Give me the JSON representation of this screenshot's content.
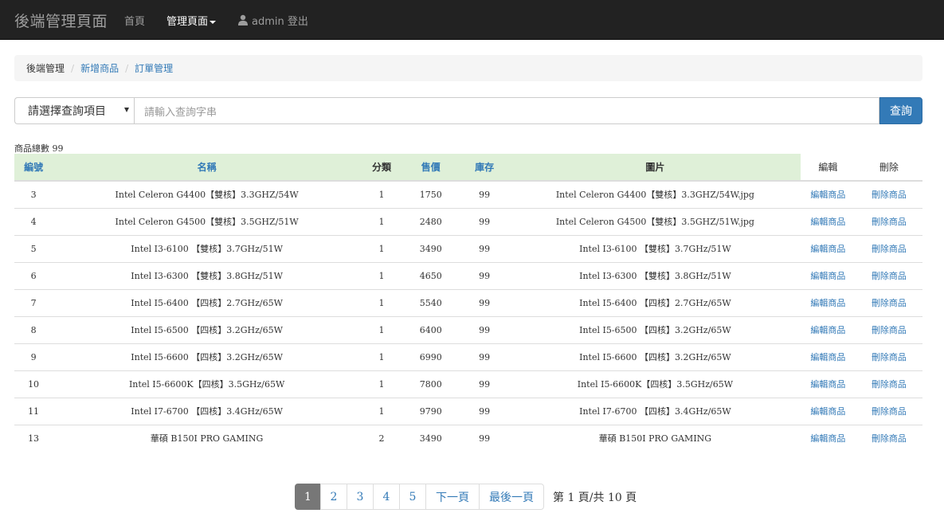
{
  "navbar": {
    "brand": "後端管理頁面",
    "home": "首頁",
    "manage": "管理頁面",
    "user": "admin 登出"
  },
  "breadcrumb": {
    "current": "後端管理",
    "add_product": "新增商品",
    "orders": "訂單管理"
  },
  "search": {
    "select_value": "請選擇查詢項目",
    "placeholder": "請輸入查詢字串",
    "button": "查詢"
  },
  "count_text": "商品總數 99",
  "table": {
    "headers": {
      "id": "編號",
      "name": "名稱",
      "category": "分類",
      "price": "售價",
      "stock": "庫存",
      "image": "圖片",
      "edit": "編輯",
      "delete": "刪除"
    },
    "edit_link": "編輯商品",
    "delete_link": "刪除商品",
    "rows": [
      {
        "id": "3",
        "name": "Intel Celeron G4400【雙核】3.3GHZ/54W",
        "category": "1",
        "price": "1750",
        "stock": "99",
        "image": "Intel Celeron G4400【雙核】3.3GHZ/54W.jpg"
      },
      {
        "id": "4",
        "name": "Intel Celeron G4500【雙核】3.5GHZ/51W",
        "category": "1",
        "price": "2480",
        "stock": "99",
        "image": "Intel Celeron G4500【雙核】3.5GHZ/51W.jpg"
      },
      {
        "id": "5",
        "name": "Intel I3-6100 【雙核】3.7GHz/51W",
        "category": "1",
        "price": "3490",
        "stock": "99",
        "image": "Intel I3-6100 【雙核】3.7GHz/51W"
      },
      {
        "id": "6",
        "name": "Intel I3-6300 【雙核】3.8GHz/51W",
        "category": "1",
        "price": "4650",
        "stock": "99",
        "image": "Intel I3-6300 【雙核】3.8GHz/51W"
      },
      {
        "id": "7",
        "name": "Intel I5-6400 【四核】2.7GHz/65W",
        "category": "1",
        "price": "5540",
        "stock": "99",
        "image": "Intel I5-6400 【四核】2.7GHz/65W"
      },
      {
        "id": "8",
        "name": "Intel I5-6500 【四核】3.2GHz/65W",
        "category": "1",
        "price": "6400",
        "stock": "99",
        "image": "Intel I5-6500 【四核】3.2GHz/65W"
      },
      {
        "id": "9",
        "name": "Intel I5-6600 【四核】3.2GHz/65W",
        "category": "1",
        "price": "6990",
        "stock": "99",
        "image": "Intel I5-6600 【四核】3.2GHz/65W"
      },
      {
        "id": "10",
        "name": "Intel I5-6600K【四核】3.5GHz/65W",
        "category": "1",
        "price": "7800",
        "stock": "99",
        "image": "Intel I5-6600K【四核】3.5GHz/65W"
      },
      {
        "id": "11",
        "name": "Intel I7-6700 【四核】3.4GHz/65W",
        "category": "1",
        "price": "9790",
        "stock": "99",
        "image": "Intel I7-6700 【四核】3.4GHz/65W"
      },
      {
        "id": "13",
        "name": "華碩 B150I PRO GAMING",
        "category": "2",
        "price": "3490",
        "stock": "99",
        "image": "華碩 B150I PRO GAMING"
      }
    ]
  },
  "pagination": {
    "pages": [
      "1",
      "2",
      "3",
      "4",
      "5"
    ],
    "next": "下一頁",
    "last": "最後一頁",
    "info": "第 1 頁/共 10 頁"
  }
}
